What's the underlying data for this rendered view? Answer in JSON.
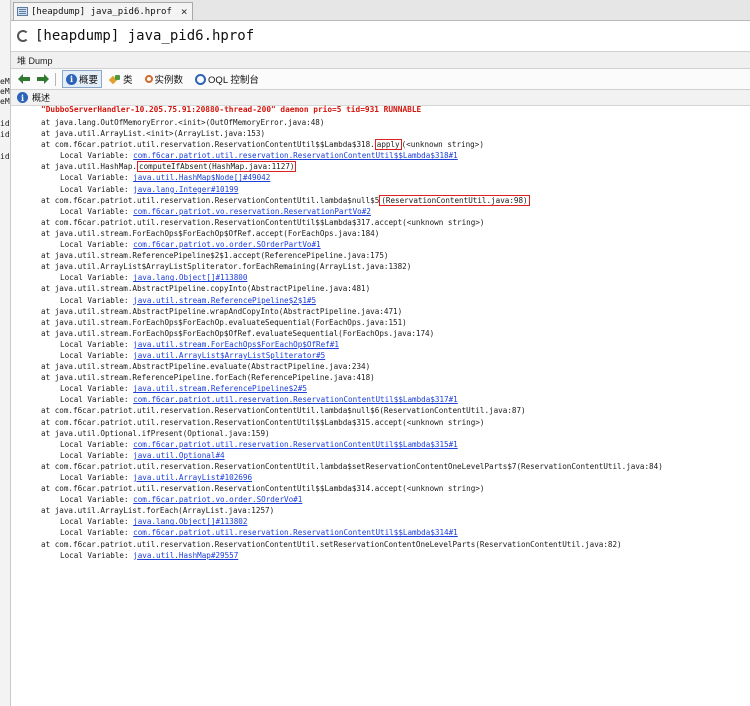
{
  "tab": {
    "title": "[heapdump] java_pid6.hprof",
    "close": "×"
  },
  "window": {
    "title": "[heapdump] java_pid6.hprof"
  },
  "toolbar1": {
    "label": "堆 Dump"
  },
  "toolbar2": {
    "summary": "概要",
    "classes": "类",
    "instances": "实例数",
    "oql": "OQL 控制台"
  },
  "section": {
    "label": "概述"
  },
  "left_strip": [
    "eM",
    "eM",
    "eM",
    "id",
    "id",
    "id"
  ],
  "stack": [
    {
      "type": "thread",
      "text": "\"DubboServerHandler-10.205.75.91:20880-thread-200\" daemon prio=5 tid=931 RUNNABLE"
    },
    {
      "type": "at",
      "text": "at java.lang.OutOfMemoryError.<init>(OutOfMemoryError.java:48)"
    },
    {
      "type": "at",
      "text": "at java.util.ArrayList.<init>(ArrayList.java:153)"
    },
    {
      "type": "at",
      "pre": "at com.f6car.patriot.util.reservation.ReservationContentUtil$$Lambda$318.",
      "hl": "apply",
      "post": "(<unknown string>)"
    },
    {
      "type": "local",
      "pre": "Local Variable: ",
      "link": "com.f6car.patriot.util.reservation.ReservationContentUtil$$Lambda$318#1"
    },
    {
      "type": "at",
      "pre": "at java.util.HashMap.",
      "hl": "computeIfAbsent(HashMap.java:1127)",
      "post": ""
    },
    {
      "type": "local",
      "pre": "Local Variable: ",
      "link": "java.util.HashMap$Node[]#49042"
    },
    {
      "type": "local",
      "pre": "Local Variable: ",
      "link": "java.lang.Integer#10199"
    },
    {
      "type": "at",
      "pre": "at com.f6car.patriot.util.reservation.ReservationContentUtil.lambda$null$5",
      "hl": "(ReservationContentUtil.java:98)",
      "post": ""
    },
    {
      "type": "local",
      "pre": "Local Variable: ",
      "link": "com.f6car.patriot.vo.reservation.ReservationPartVo#2"
    },
    {
      "type": "at",
      "text": "at com.f6car.patriot.util.reservation.ReservationContentUtil$$Lambda$317.accept(<unknown string>)"
    },
    {
      "type": "at",
      "text": "at java.util.stream.ForEachOps$ForEachOp$OfRef.accept(ForEachOps.java:184)"
    },
    {
      "type": "local",
      "pre": "Local Variable: ",
      "link": "com.f6car.patriot.vo.order.SOrderPartVo#1"
    },
    {
      "type": "at",
      "text": "at java.util.stream.ReferencePipeline$2$1.accept(ReferencePipeline.java:175)"
    },
    {
      "type": "at",
      "text": "at java.util.ArrayList$ArrayListSpliterator.forEachRemaining(ArrayList.java:1382)"
    },
    {
      "type": "local",
      "pre": "Local Variable: ",
      "link": "java.lang.Object[]#113800"
    },
    {
      "type": "at",
      "text": "at java.util.stream.AbstractPipeline.copyInto(AbstractPipeline.java:481)"
    },
    {
      "type": "local",
      "pre": "Local Variable: ",
      "link": "java.util.stream.ReferencePipeline$2$1#5"
    },
    {
      "type": "at",
      "text": "at java.util.stream.AbstractPipeline.wrapAndCopyInto(AbstractPipeline.java:471)"
    },
    {
      "type": "at",
      "text": "at java.util.stream.ForEachOps$ForEachOp.evaluateSequential(ForEachOps.java:151)"
    },
    {
      "type": "at",
      "text": "at java.util.stream.ForEachOps$ForEachOp$OfRef.evaluateSequential(ForEachOps.java:174)"
    },
    {
      "type": "local",
      "pre": "Local Variable: ",
      "link": "java.util.stream.ForEachOps$ForEachOp$OfRef#1"
    },
    {
      "type": "local",
      "pre": "Local Variable: ",
      "link": "java.util.ArrayList$ArrayListSpliterator#5"
    },
    {
      "type": "at",
      "text": "at java.util.stream.AbstractPipeline.evaluate(AbstractPipeline.java:234)"
    },
    {
      "type": "at",
      "text": "at java.util.stream.ReferencePipeline.forEach(ReferencePipeline.java:418)"
    },
    {
      "type": "local",
      "pre": "Local Variable: ",
      "link": "java.util.stream.ReferencePipeline$2#5"
    },
    {
      "type": "local",
      "pre": "Local Variable: ",
      "link": "com.f6car.patriot.util.reservation.ReservationContentUtil$$Lambda$317#1"
    },
    {
      "type": "at",
      "text": "at com.f6car.patriot.util.reservation.ReservationContentUtil.lambda$null$6(ReservationContentUtil.java:87)"
    },
    {
      "type": "at",
      "text": "at com.f6car.patriot.util.reservation.ReservationContentUtil$$Lambda$315.accept(<unknown string>)"
    },
    {
      "type": "at",
      "text": "at java.util.Optional.ifPresent(Optional.java:159)"
    },
    {
      "type": "local",
      "pre": "Local Variable: ",
      "link": "com.f6car.patriot.util.reservation.ReservationContentUtil$$Lambda$315#1"
    },
    {
      "type": "local",
      "pre": "Local Variable: ",
      "link": "java.util.Optional#4"
    },
    {
      "type": "at",
      "text": "at com.f6car.patriot.util.reservation.ReservationContentUtil.lambda$setReservationContentOneLevelParts$7(ReservationContentUtil.java:84)"
    },
    {
      "type": "local",
      "pre": "Local Variable: ",
      "link": "java.util.ArrayList#102696"
    },
    {
      "type": "at",
      "text": "at com.f6car.patriot.util.reservation.ReservationContentUtil$$Lambda$314.accept(<unknown string>)"
    },
    {
      "type": "local",
      "pre": "Local Variable: ",
      "link": "com.f6car.patriot.vo.order.SOrderVo#1"
    },
    {
      "type": "at",
      "text": "at java.util.ArrayList.forEach(ArrayList.java:1257)"
    },
    {
      "type": "local",
      "pre": "Local Variable: ",
      "link": "java.lang.Object[]#113802"
    },
    {
      "type": "local",
      "pre": "Local Variable: ",
      "link": "com.f6car.patriot.util.reservation.ReservationContentUtil$$Lambda$314#1"
    },
    {
      "type": "at",
      "text": "at com.f6car.patriot.util.reservation.ReservationContentUtil.setReservationContentOneLevelParts(ReservationContentUtil.java:82)"
    },
    {
      "type": "local",
      "pre": "Local Variable: ",
      "link": "java.util.HashMap#29557"
    }
  ]
}
